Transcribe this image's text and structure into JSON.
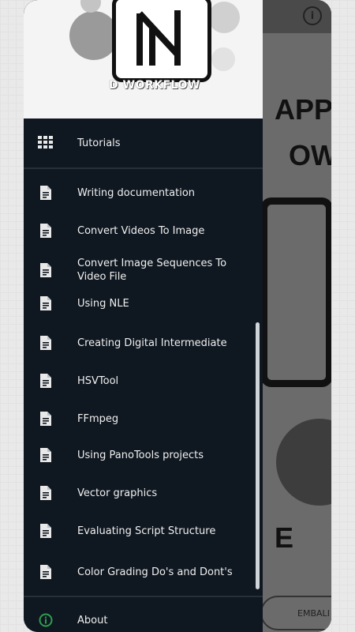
{
  "header": {
    "logo_letter": "N",
    "logo_caption": "D WORKFLOW"
  },
  "app": {
    "big_text_lines": [
      "APP",
      "OW",
      "E"
    ],
    "button_label": "EMBALI"
  },
  "menu": {
    "tutorials": "Tutorials",
    "items": [
      "Writing documentation",
      "Convert Videos To Image",
      "Convert Image Sequences To Video File",
      "Using NLE",
      "Creating Digital Intermediate",
      "HSVTool",
      "FFmpeg",
      "Using PanoTools projects",
      "Vector graphics",
      "Evaluating Script Structure",
      "Color Grading Do's and Dont's"
    ],
    "about": "About"
  },
  "icons": {
    "tutorials": "grid-icon",
    "item": "document-icon",
    "about": "info-icon"
  },
  "colors": {
    "drawer_bg": "#0f1720",
    "header_bg": "#f4f4f4",
    "about_icon": "#2e9e4f"
  }
}
